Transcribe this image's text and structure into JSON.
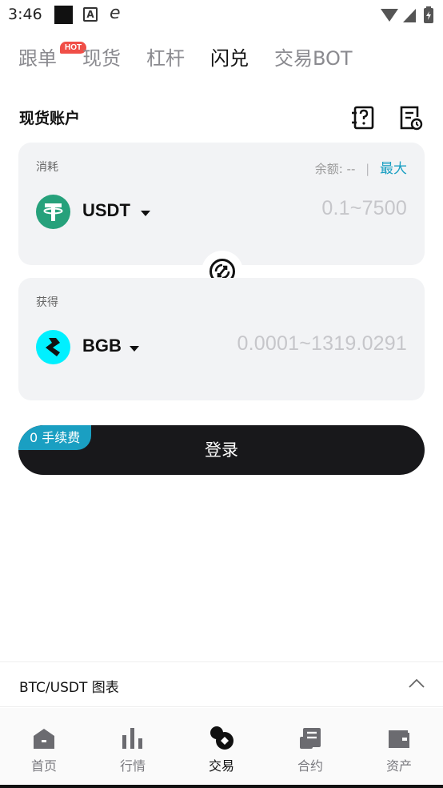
{
  "status_bar": {
    "time": "3:46",
    "app_icon_letter": "A"
  },
  "tabs": [
    {
      "label": "跟单",
      "badge": "HOT",
      "active": false
    },
    {
      "label": "现货",
      "active": false
    },
    {
      "label": "杠杆",
      "active": false
    },
    {
      "label": "闪兑",
      "active": true
    },
    {
      "label": "交易BOT",
      "active": false
    }
  ],
  "account": {
    "title": "现货账户",
    "icons": [
      "orders-icon",
      "history-icon"
    ]
  },
  "pay_card": {
    "label": "消耗",
    "balance_label": "余额:",
    "balance_value": "--",
    "separator": "|",
    "max_label": "最大",
    "coin": "USDT",
    "amount_placeholder": "0.1~7500",
    "coin_color": "#26a17b"
  },
  "receive_card": {
    "label": "获得",
    "coin": "BGB",
    "amount_placeholder": "0.0001~1319.0291",
    "coin_color": "#00f0ff"
  },
  "login_button": {
    "label": "登录",
    "fee_badge": "0 手续费"
  },
  "chart_bar": {
    "label": "BTC/USDT 图表"
  },
  "bottom_nav": [
    {
      "label": "首页",
      "icon": "home-icon",
      "active": false
    },
    {
      "label": "行情",
      "icon": "market-icon",
      "active": false
    },
    {
      "label": "交易",
      "icon": "trade-icon",
      "active": true
    },
    {
      "label": "合约",
      "icon": "futures-icon",
      "active": false
    },
    {
      "label": "资产",
      "icon": "wallet-icon",
      "active": false
    }
  ],
  "colors": {
    "accent": "#1a9fc2",
    "hot": "#f04e47",
    "button": "#18181b",
    "card_bg": "#f2f3f5"
  }
}
